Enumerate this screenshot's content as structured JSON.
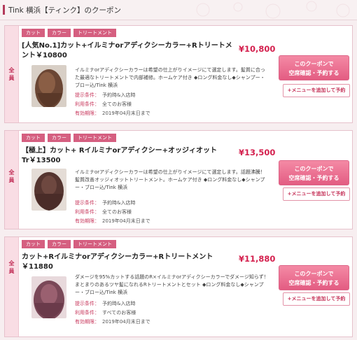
{
  "header": {
    "title": "Tink 横浜【ティンク】のクーポン"
  },
  "coupons": [
    {
      "member": "全員",
      "tags": [
        "カット",
        "カラー",
        "トリートメント"
      ],
      "title_line1": "[人気No.1]カット+イルミナorアディクシーカラー+Rトリートメ",
      "title_line2": "ント￥10800",
      "price": "¥10,800",
      "desc": "イルミナorアディクシーカラーは希望の仕上がりイメージにて選定します。髪質に合った最適なトリートメントで内部補修。ホームケア付き ◆ロング料金なし◆シャンプー・ブロー込/Tink 横浜",
      "cond_label": "提示条件：",
      "cond_value": "予約時&入店時",
      "use_label": "利用条件：",
      "use_value": "全てのお客様",
      "exp_label": "有効期限：",
      "exp_value": "2019年04月末日まで",
      "btn_main_1": "このクーポンで",
      "btn_main_2": "空席確認・予約する",
      "btn_sub": "+メニューを追加して予約"
    },
    {
      "member": "全員",
      "tags": [
        "カット",
        "カラー",
        "トリートメント"
      ],
      "title_line1": "【極上】カット+ Rイルミナorアディクシー+オッジィオット",
      "title_line2": "Tr￥13500",
      "price": "¥13,500",
      "desc": "イルミナorアディクシーカラーは希望の仕上がりイメージにて選定します。話題沸騰！髪質改善オッジィオットトリートメント。ホームケア付き ◆ロング料金なし◆シャンプー・ブロー込/Tink 横浜",
      "cond_label": "提示条件：",
      "cond_value": "予約時&入店時",
      "use_label": "利用条件：",
      "use_value": "全てのお客様",
      "exp_label": "有効期限：",
      "exp_value": "2019年04月末日まで",
      "btn_main_1": "このクーポンで",
      "btn_main_2": "空席確認・予約する",
      "btn_sub": "+メニューを追加して予約"
    },
    {
      "member": "全員",
      "tags": [
        "カット",
        "カラー",
        "トリートメント"
      ],
      "title_line1": "カット+Rイルミナorアディクシーカラー+Rトリートメント",
      "title_line2": "￥11880",
      "price": "¥11,880",
      "desc": "ダメージを95%カットする話題のR×イルミナorアディクシーカラーでダメージ知らず！まとまりのあるツヤ髪になれるRトリートメントとセット ◆ロング料金なし◆シャンプー・ブロー込/Tink 横浜",
      "cond_label": "提示条件：",
      "cond_value": "予約時&入店時",
      "use_label": "利用条件：",
      "use_value": "すべてのお客様",
      "exp_label": "有効期限：",
      "exp_value": "2019年04月末日まで",
      "btn_main_1": "このクーポンで",
      "btn_main_2": "空席確認・予約する",
      "btn_sub": "+メニューを追加して予約"
    }
  ]
}
